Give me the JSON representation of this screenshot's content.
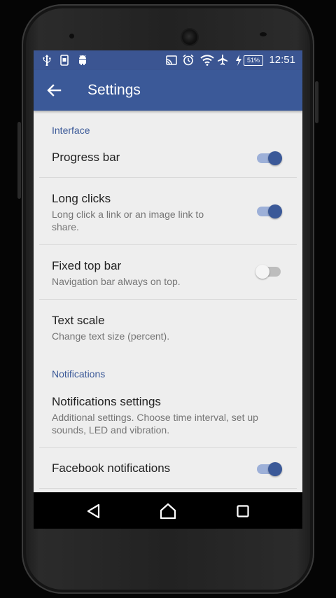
{
  "status_bar": {
    "time": "12:51",
    "battery_label": "51%",
    "left_icons": [
      "usb-icon",
      "screenshot-icon",
      "android-icon"
    ],
    "right_icons": [
      "cast-icon",
      "alarm-icon",
      "wifi-icon",
      "airplane-icon",
      "charging-icon",
      "battery-icon"
    ]
  },
  "appbar": {
    "title": "Settings",
    "back_icon": "arrow-back-icon",
    "color": "#3b5998"
  },
  "sections": {
    "interface": {
      "header": "Interface",
      "progress_bar": {
        "title": "Progress bar",
        "enabled": true
      },
      "long_clicks": {
        "title": "Long clicks",
        "subtitle": "Long click a link or an image link to share.",
        "enabled": true
      },
      "fixed_top_bar": {
        "title": "Fixed top bar",
        "subtitle": "Navigation bar always on top.",
        "enabled": false
      },
      "text_scale": {
        "title": "Text scale",
        "subtitle": "Change text size (percent)."
      }
    },
    "notifications": {
      "header": "Notifications",
      "notifications_settings": {
        "title": "Notifications settings",
        "subtitle": "Additional settings. Choose time interval, set up sounds, LED and vibration."
      },
      "facebook_notifications": {
        "title": "Facebook notifications",
        "enabled": true
      }
    }
  },
  "nav_bar": {
    "icons": [
      "back-triangle-icon",
      "home-icon",
      "recents-icon"
    ]
  },
  "colors": {
    "accent": "#3b5998",
    "status_bar": "#3b5592",
    "background": "#eeeeee"
  }
}
